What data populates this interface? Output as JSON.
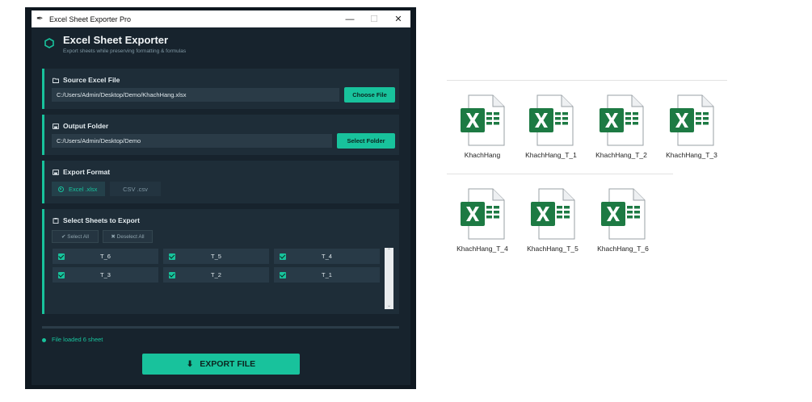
{
  "window": {
    "title": "Excel Sheet Exporter Pro",
    "minimize": "—",
    "maximize": "☐",
    "close": "✕"
  },
  "header": {
    "title": "Excel Sheet Exporter",
    "subtitle": "Export sheets while preserving formatting & formulas"
  },
  "source": {
    "label": "Source Excel File",
    "path": "C:/Users/Admin/Desktop/Demo/KhachHang.xlsx",
    "button": "Choose File"
  },
  "output": {
    "label": "Output Folder",
    "path": "C:/Users/Admin/Desktop/Demo",
    "button": "Select Folder"
  },
  "format": {
    "label": "Export Format",
    "options": [
      {
        "label": "Excel .xlsx",
        "selected": true
      },
      {
        "label": "CSV .csv",
        "selected": false
      }
    ]
  },
  "sheets": {
    "label": "Select Sheets to Export",
    "select_all": "✔ Select All",
    "deselect_all": "✖ Deselect All",
    "items": [
      {
        "name": "T_6",
        "checked": true
      },
      {
        "name": "T_5",
        "checked": true
      },
      {
        "name": "T_4",
        "checked": true
      },
      {
        "name": "T_3",
        "checked": true
      },
      {
        "name": "T_2",
        "checked": true
      },
      {
        "name": "T_1",
        "checked": true
      }
    ]
  },
  "status": {
    "text": "File loaded 6 sheet"
  },
  "export_button": "EXPORT FILE",
  "explorer": {
    "files": [
      {
        "name": "KhachHang"
      },
      {
        "name": "KhachHang_T_1"
      },
      {
        "name": "KhachHang_T_2"
      },
      {
        "name": "KhachHang_T_3"
      },
      {
        "name": "KhachHang_T_4"
      },
      {
        "name": "KhachHang_T_5"
      },
      {
        "name": "KhachHang_T_6"
      }
    ]
  },
  "colors": {
    "accent": "#18c29c",
    "window_bg": "#17232d",
    "card_bg": "#1e2d38",
    "excel_green": "#1d7a43"
  }
}
